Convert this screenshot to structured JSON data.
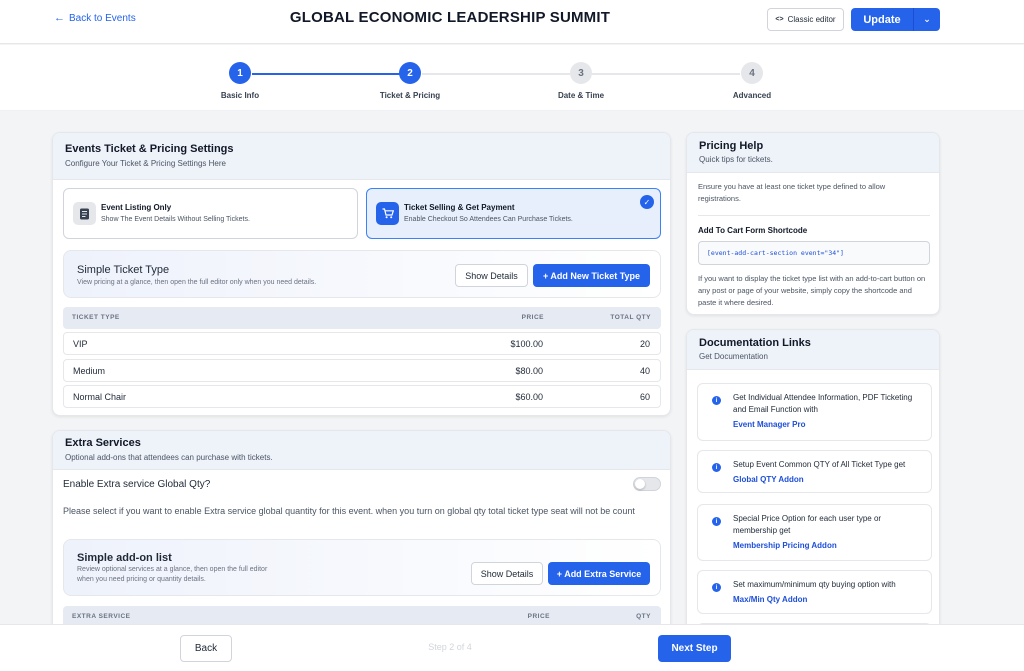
{
  "header": {
    "back_label": "Back to Events",
    "title": "GLOBAL ECONOMIC LEADERSHIP SUMMIT",
    "classic_editor_label": "Classic editor",
    "update_label": "Update"
  },
  "stepper": {
    "steps": [
      {
        "number": "1",
        "label": "Basic Info",
        "state": "active"
      },
      {
        "number": "2",
        "label": "Ticket & Pricing",
        "state": "active"
      },
      {
        "number": "3",
        "label": "Date & Time",
        "state": "pending"
      },
      {
        "number": "4",
        "label": "Advanced",
        "state": "pending"
      }
    ],
    "current_step": 2,
    "total_steps": 4
  },
  "ticket_settings": {
    "title": "Events Ticket & Pricing Settings",
    "subtitle": "Configure Your Ticket & Pricing Settings Here",
    "options": [
      {
        "title": "Event Listing Only",
        "desc": "Show The Event Details Without Selling Tickets.",
        "icon": "document-icon",
        "selected": false
      },
      {
        "title": "Ticket Selling & Get Payment",
        "desc": "Enable Checkout So Attendees Can Purchase Tickets.",
        "icon": "cart-icon",
        "selected": true
      }
    ],
    "simple_panel": {
      "title": "Simple Ticket Type",
      "desc": "View pricing at a glance, then open the full editor only when you need details.",
      "show_details_label": "Show Details",
      "add_label": "+ Add New Ticket Type"
    },
    "table": {
      "headers": [
        "TICKET TYPE",
        "PRICE",
        "TOTAL QTY"
      ],
      "rows": [
        {
          "type": "VIP",
          "price": "$100.00",
          "qty": "20"
        },
        {
          "type": "Medium",
          "price": "$80.00",
          "qty": "40"
        },
        {
          "type": "Normal Chair",
          "price": "$60.00",
          "qty": "60"
        }
      ]
    }
  },
  "extra_services": {
    "title": "Extra Services",
    "subtitle": "Optional add-ons that attendees can purchase with tickets.",
    "global_qty_label": "Enable Extra service Global Qty?",
    "global_qty_enabled": false,
    "global_qty_help": "Please select if you want to enable Extra service global quantity for this event. when you turn on global qty total ticket type seat will not be count",
    "simple_panel": {
      "title": "Simple add-on list",
      "desc_line1": "Review optional services at a glance, then open the full editor",
      "desc_line2": "when you need pricing or quantity details.",
      "show_details_label": "Show Details",
      "add_label": "+ Add Extra Service"
    },
    "table": {
      "headers": [
        "EXTRA SERVICE",
        "PRICE",
        "QTY"
      ]
    }
  },
  "pricing_help": {
    "title": "Pricing Help",
    "subtitle": "Quick tips for tickets.",
    "intro": "Ensure you have at least one ticket type defined to allow registrations.",
    "shortcode_title": "Add To Cart Form Shortcode",
    "shortcode": "[event-add-cart-section event=\"34\"]",
    "shortcode_help": "If you want to display the ticket type list with an add-to-cart button on any post or page of your website, simply copy the shortcode and paste it where desired."
  },
  "documentation": {
    "title": "Documentation Links",
    "subtitle": "Get Documentation",
    "items": [
      {
        "text": "Get Individual Attendee Information, PDF Ticketing and Email Function with",
        "link": "Event Manager Pro"
      },
      {
        "text": "Setup Event Common QTY of All Ticket Type get",
        "link": "Global QTY Addon"
      },
      {
        "text": "Special Price Option for each user type or membership get",
        "link": "Membership Pricing Addon"
      },
      {
        "text": "Set maximum/minimum qty buying option with",
        "link": "Max/Min Qty Addon"
      }
    ]
  },
  "footer": {
    "back_label": "Back",
    "step_text": "Step 2 of 4",
    "next_label": "Next Step"
  },
  "colors": {
    "accent": "#2563eb",
    "page_bg": "#f3f4f6",
    "card_head_bg": "#eef2f9"
  }
}
